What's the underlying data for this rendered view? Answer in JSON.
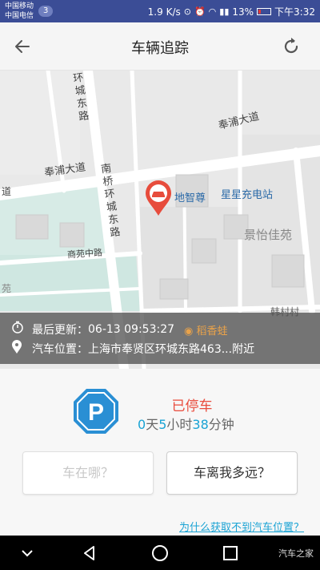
{
  "status_bar": {
    "carrier_1": "中国移动",
    "carrier_2": "中国电信",
    "sim_badge": "3",
    "speed": "1.9 K/s",
    "battery": "13%",
    "time": "下午3:32"
  },
  "header": {
    "title": "车辆追踪",
    "back_icon": "arrow-left-icon",
    "refresh_icon": "refresh-icon"
  },
  "map": {
    "roads": [
      "环城东路",
      "奉浦大道",
      "奉浦大道",
      "南桥环城东路",
      "商苑中路",
      "韩村路"
    ],
    "labels": [
      "地智尊",
      "星星充电站",
      "景怡佳苑",
      "稻香蛙",
      "韩村村",
      "苑",
      "道"
    ],
    "marker_icon": "car-location-pin-icon"
  },
  "info": {
    "last_update_label": "最后更新：",
    "last_update_value": "06-13 09:53:27",
    "location_label": "汽车位置：",
    "location_value": "上海市奉贤区环城东路463...附近"
  },
  "parking": {
    "icon": "parking-sign-icon",
    "status": "已停车",
    "days": "0",
    "days_unit": "天",
    "hours": "5",
    "hours_unit": "小时",
    "minutes": "38",
    "minutes_unit": "分钟"
  },
  "buttons": {
    "where_label": "车在哪？",
    "distance_label": "车离我多远？"
  },
  "help_link": "为什么获取不到汽车位置？",
  "nav": {
    "icons": [
      "chevron-down-icon",
      "back-triangle-icon",
      "home-circle-icon",
      "recents-square-icon"
    ],
    "watermark": "汽车之家"
  },
  "colors": {
    "status_bar": "#3b4d96",
    "accent_blue": "#1aa3d4",
    "status_red": "#e94c3d",
    "parking_blue": "#2a8fd4"
  }
}
